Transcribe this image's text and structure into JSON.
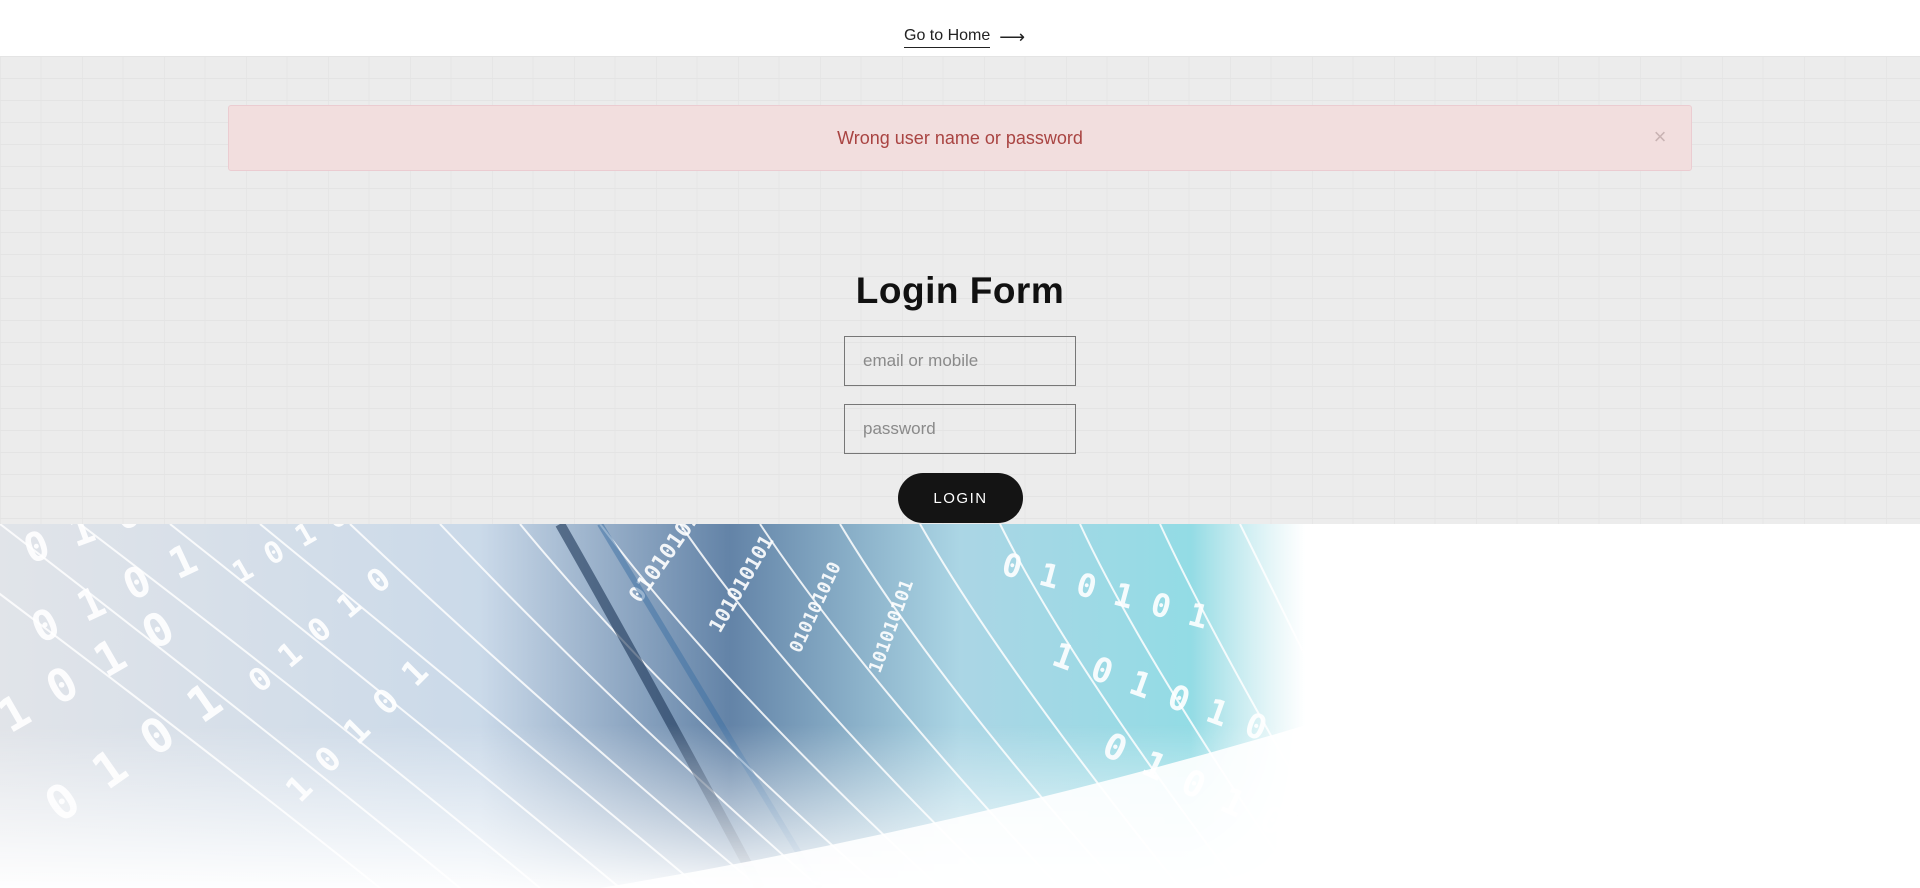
{
  "header": {
    "home_link_label": "Go to Home",
    "home_link_arrow": "⟶"
  },
  "alert": {
    "message": "Wrong user name or password",
    "close_symbol": "×"
  },
  "login_form": {
    "title": "Login Form",
    "email_placeholder": "email or mobile",
    "password_placeholder": "password",
    "submit_label": "LOGIN"
  },
  "decorative_binary": {
    "digits": "0101101001011010100101101011010010"
  },
  "colors": {
    "alert_bg": "#f2dede",
    "alert_text": "#a94442",
    "button_bg": "#141414",
    "accent_blue": "#3f7fb0",
    "accent_cyan": "#5ec7d6"
  }
}
